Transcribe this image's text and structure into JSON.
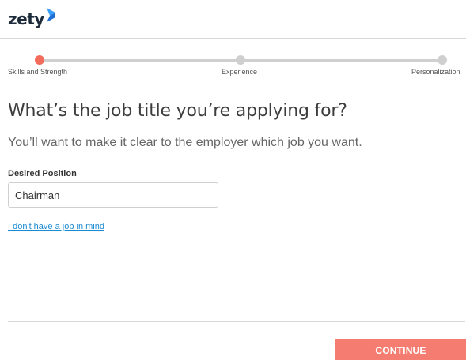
{
  "brand": {
    "logo_text": "zety",
    "logo_color": "#1d2b3a",
    "mark_colors": [
      "#3aa0ff",
      "#1f6fd6"
    ]
  },
  "progress": {
    "steps": [
      {
        "label": "Skills and Strength",
        "state": "active"
      },
      {
        "label": "Experience",
        "state": "inactive"
      },
      {
        "label": "Personalization",
        "state": "inactive"
      }
    ],
    "active_color": "#f26b5b",
    "inactive_color": "#cfcfcf"
  },
  "main": {
    "title": "What’s the job title you’re applying for?",
    "subtitle": "You’ll want to make it clear to the employer which job you want.",
    "field_label": "Desired Position",
    "field_value": "Chairman",
    "no_job_link": "I don't have a job in mind"
  },
  "footer": {
    "continue_label": "CONTINUE",
    "continue_color": "#f47c70"
  }
}
